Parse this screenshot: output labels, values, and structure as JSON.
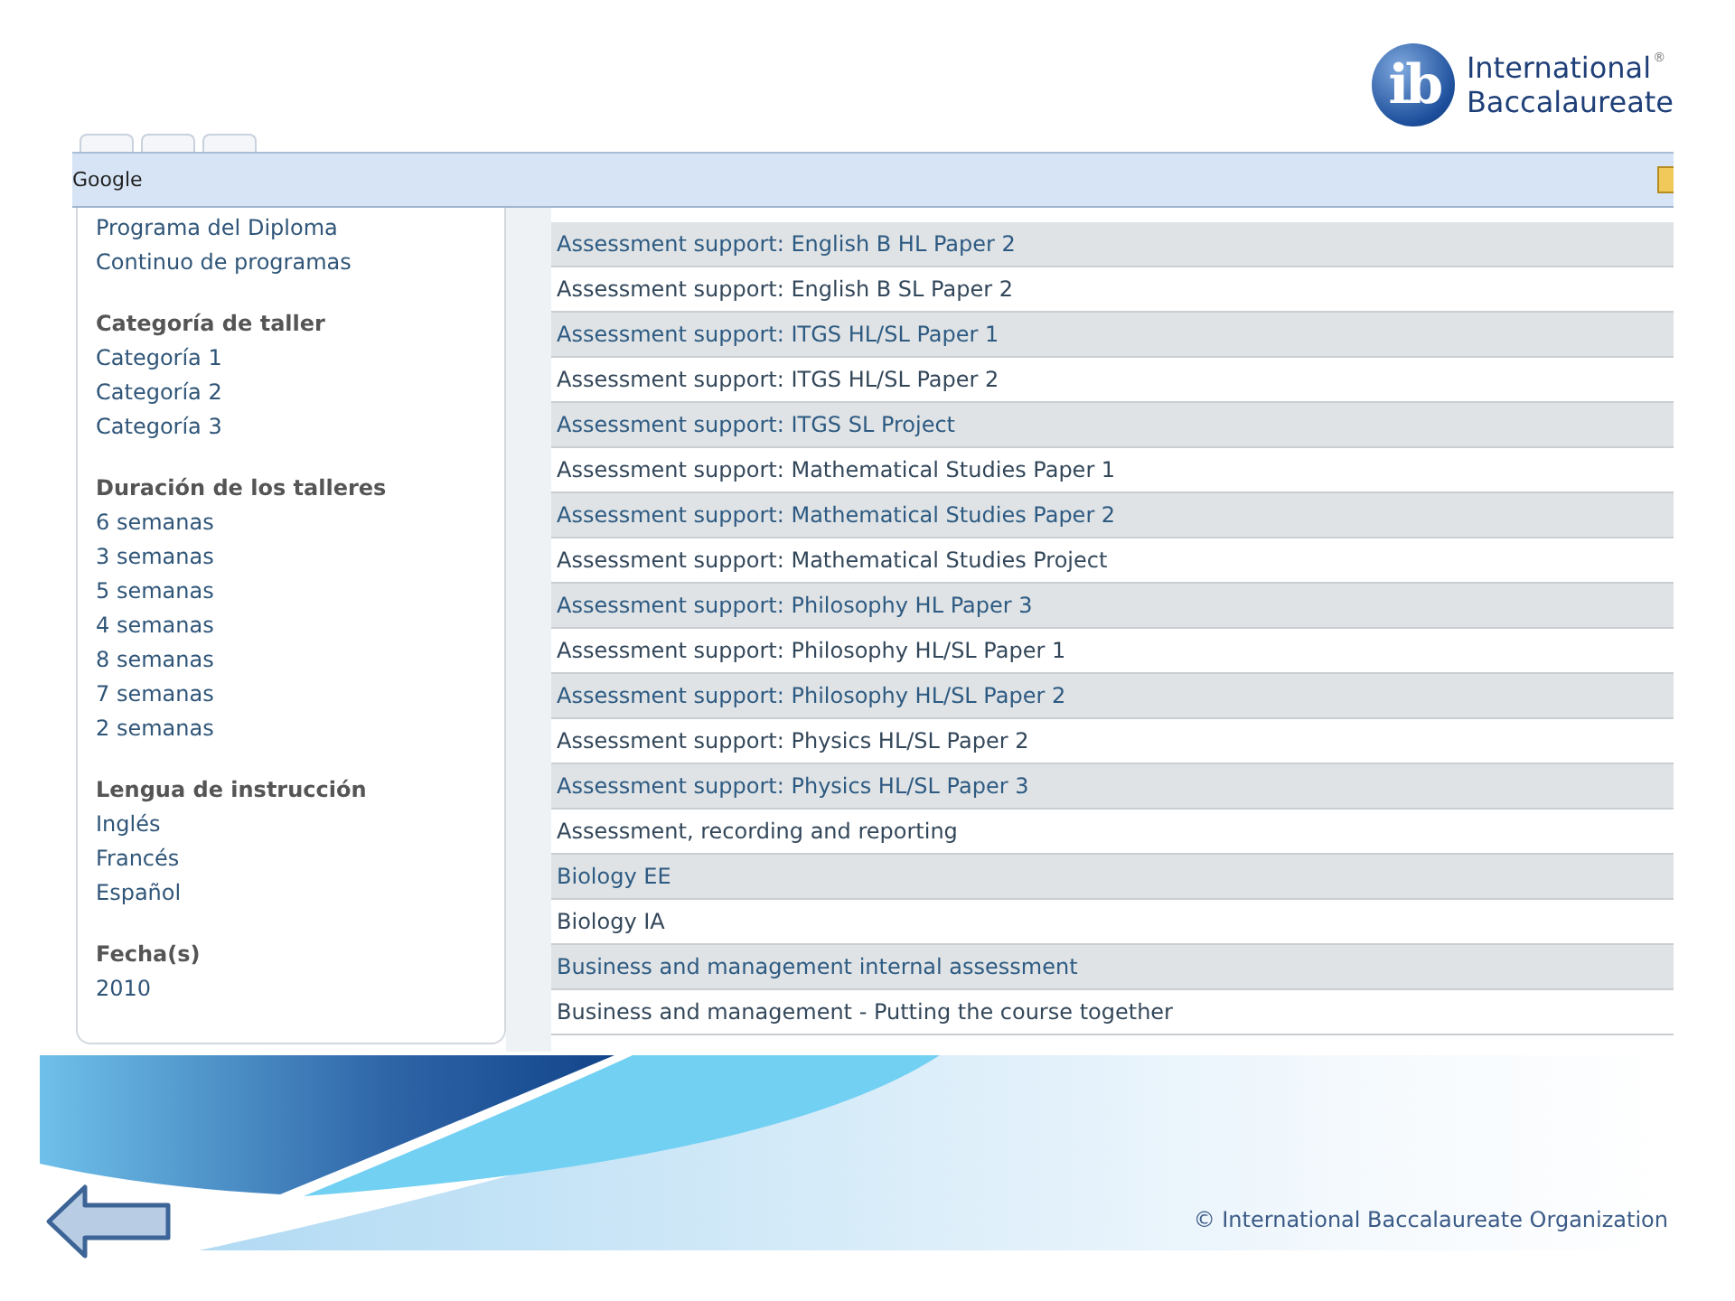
{
  "logo": {
    "mark": "ib",
    "name_lines": [
      "International",
      "Baccalaureate"
    ],
    "registered": "®"
  },
  "browser": {
    "toolbar_label": "Google"
  },
  "filters": {
    "top_items": [
      "Programa del Diploma",
      "Continuo de programas"
    ],
    "groups": [
      {
        "heading": "Categoría de taller",
        "items": [
          "Categoría 1",
          "Categoría 2",
          "Categoría 3"
        ]
      },
      {
        "heading": "Duración de los talleres",
        "items": [
          "6 semanas",
          "3 semanas",
          "5 semanas",
          "4 semanas",
          "8 semanas",
          "7 semanas",
          "2 semanas"
        ]
      },
      {
        "heading": "Lengua de instrucción",
        "items": [
          "Inglés",
          "Francés",
          "Español"
        ]
      },
      {
        "heading": "Fecha(s)",
        "items": [
          "2010"
        ]
      }
    ]
  },
  "results": [
    "Assessment support: English B HL Paper 2",
    "Assessment support: English B SL Paper 2",
    "Assessment support: ITGS HL/SL Paper 1",
    "Assessment support: ITGS HL/SL Paper 2",
    "Assessment support: ITGS SL Project",
    "Assessment support: Mathematical Studies Paper 1",
    "Assessment support: Mathematical Studies Paper 2",
    "Assessment support: Mathematical Studies Project",
    "Assessment support: Philosophy HL Paper 3",
    "Assessment support: Philosophy HL/SL Paper 1",
    "Assessment support: Philosophy HL/SL Paper 2",
    "Assessment support: Physics HL/SL Paper 2",
    "Assessment support: Physics HL/SL Paper 3",
    "Assessment, recording and reporting",
    "Biology EE",
    "Biology IA",
    "Business and management internal assessment",
    "Business and management - Putting the course together"
  ],
  "footer": {
    "copyright": "© International Baccalaureate Organization"
  }
}
